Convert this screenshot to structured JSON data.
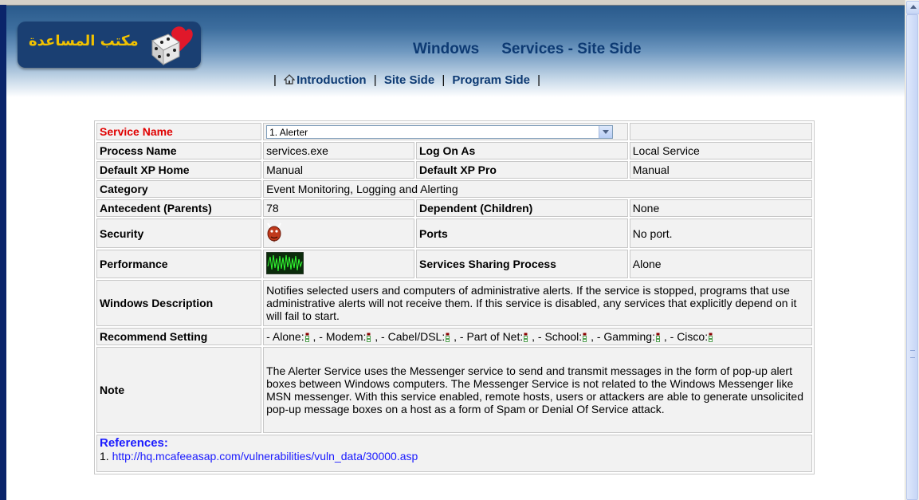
{
  "header": {
    "logo_text": "مكتب المساعدة",
    "title_part1": "Windows",
    "title_part2": "Services - Site Side"
  },
  "nav": {
    "items": [
      {
        "label": "Introduction"
      },
      {
        "label": "Site Side"
      },
      {
        "label": "Program Side"
      }
    ],
    "separator": "|"
  },
  "service": {
    "name_label": "Service Name",
    "selected": "1. Alerter",
    "process_name_label": "Process Name",
    "process_name": "services.exe",
    "log_on_as_label": "Log On As",
    "log_on_as": "Local Service",
    "default_xp_home_label": "Default XP Home",
    "default_xp_home": "Manual",
    "default_xp_pro_label": "Default XP Pro",
    "default_xp_pro": "Manual",
    "category_label": "Category",
    "category": "Event Monitoring, Logging and Alerting",
    "antecedent_label": "Antecedent (Parents)",
    "antecedent": "78",
    "dependent_label": "Dependent (Children)",
    "dependent": "None",
    "security_label": "Security",
    "ports_label": "Ports",
    "ports": "No port.",
    "performance_label": "Performance",
    "sharing_label": "Services Sharing Process",
    "sharing": "Alone",
    "windows_description_label": "Windows Description",
    "windows_description": "Notifies selected users and computers of administrative alerts. If the service is stopped, programs that use administrative alerts will not receive them. If this service is disabled, any services that explicitly depend on it will fail to start.",
    "recommend_label": "Recommend Setting",
    "recommend": [
      {
        "label": "- Alone:"
      },
      {
        "label": ", - Modem:"
      },
      {
        "label": ", - Cabel/DSL:"
      },
      {
        "label": ", - Part of Net:"
      },
      {
        "label": ", - School:"
      },
      {
        "label": ", - Gamming:"
      },
      {
        "label": ", - Cisco:"
      }
    ],
    "note_label": "Note",
    "note": "The Alerter Service uses the Messenger service to send and transmit messages in the form of pop-up alert boxes between Windows computers. The Messenger Service is not related to the Windows Messenger like MSN messenger. With this service enabled, remote hosts, users or attackers are able to generate unsolicited pop-up message boxes on a host as a form of Spam or Denial Of Service attack.",
    "references_label": "References:",
    "references": [
      {
        "num": "1.",
        "url": "http://hq.mcafeeasap.com/vulnerabilities/vuln_data/30000.asp"
      }
    ]
  },
  "colors": {
    "label_blue": "#1a1aff",
    "label_red": "#e00000",
    "header_blue": "#0d3a73"
  }
}
